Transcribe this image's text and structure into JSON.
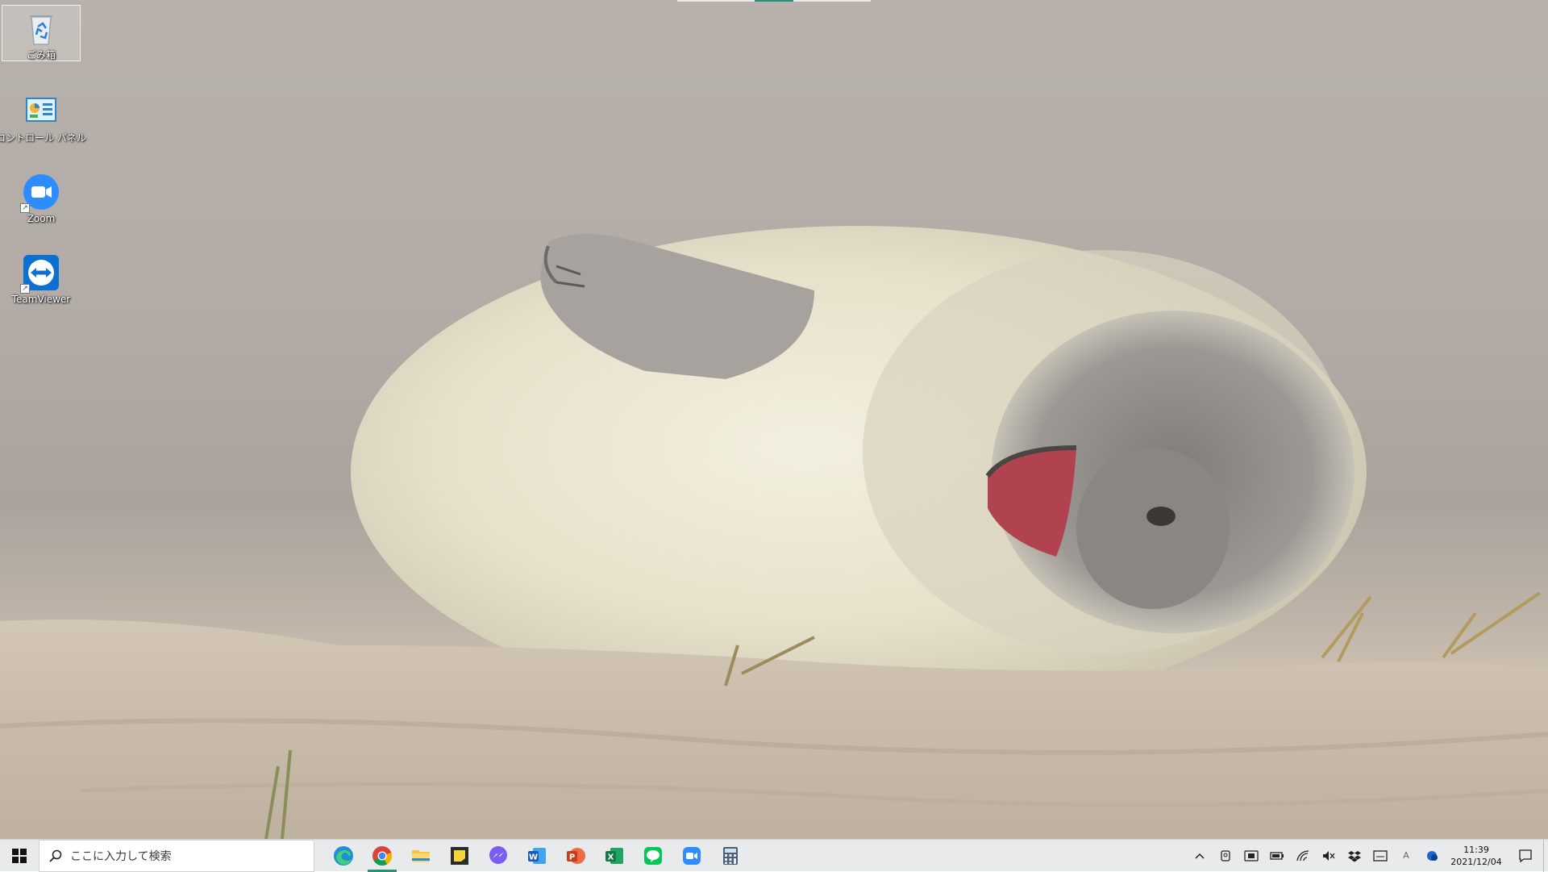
{
  "desktop": {
    "wallpaper": "seal-pup-on-sand",
    "icons": [
      {
        "label": "ごみ箱",
        "icon": "recycle-bin-icon"
      },
      {
        "label": "コントロール パネル",
        "icon": "control-panel-icon"
      },
      {
        "label": "Zoom",
        "icon": "zoom-icon"
      },
      {
        "label": "TeamViewer",
        "icon": "teamviewer-icon"
      }
    ]
  },
  "taskbar": {
    "search_placeholder": "ここに入力して検索",
    "pinned_apps": [
      "edge",
      "chrome",
      "file-explorer",
      "sticky-notes",
      "messenger",
      "word",
      "powerpoint",
      "excel",
      "line",
      "zoom",
      "calculator"
    ],
    "active_app": "chrome",
    "clock": {
      "time": "11:39",
      "date": "2021/12/04"
    },
    "tray_ime": "A"
  },
  "colors": {
    "taskbar_bg": "#e8eaec",
    "active_indicator": "#2e8c77"
  }
}
